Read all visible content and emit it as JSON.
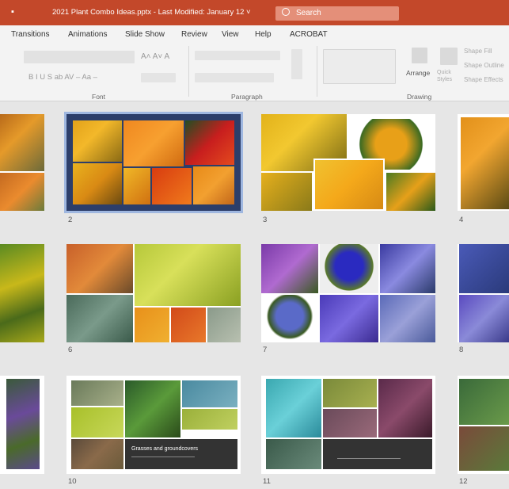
{
  "titlebar": {
    "title": "2021 Plant Combo Ideas.pptx  -  Last Modified: January 12  ˅",
    "search_placeholder": "Search",
    "save_icon": "save-icon",
    "search_icon": "search-icon"
  },
  "menu": [
    "Transitions",
    "Animations",
    "Slide Show",
    "Review",
    "View",
    "Help",
    "ACROBAT"
  ],
  "ribbon": {
    "groups": [
      "Font",
      "Paragraph",
      "Drawing"
    ],
    "font_buttons": "B  I  U  S  ab  AV –  Aa –",
    "font_size_buttons": "A˄ A˅ A",
    "arrange_label": "Arrange",
    "quick_styles_label": "Quick Styles",
    "shape_fill": "Shape Fill",
    "shape_outline": "Shape Outline",
    "shape_effects": "Shape Effects"
  },
  "slides": [
    {
      "number": "2",
      "selected": true
    },
    {
      "number": "3"
    },
    {
      "number": "4"
    },
    {
      "number": "6"
    },
    {
      "number": "7"
    },
    {
      "number": "8"
    },
    {
      "number": "10",
      "caption": "Grasses and groundcovers"
    },
    {
      "number": "11"
    },
    {
      "number": "12"
    }
  ],
  "colors": {
    "titlebar": "#c3482a",
    "ribbon": "#f3f3f3",
    "sorter_bg": "#e6e6e6",
    "selection": "#9fb7e0"
  }
}
